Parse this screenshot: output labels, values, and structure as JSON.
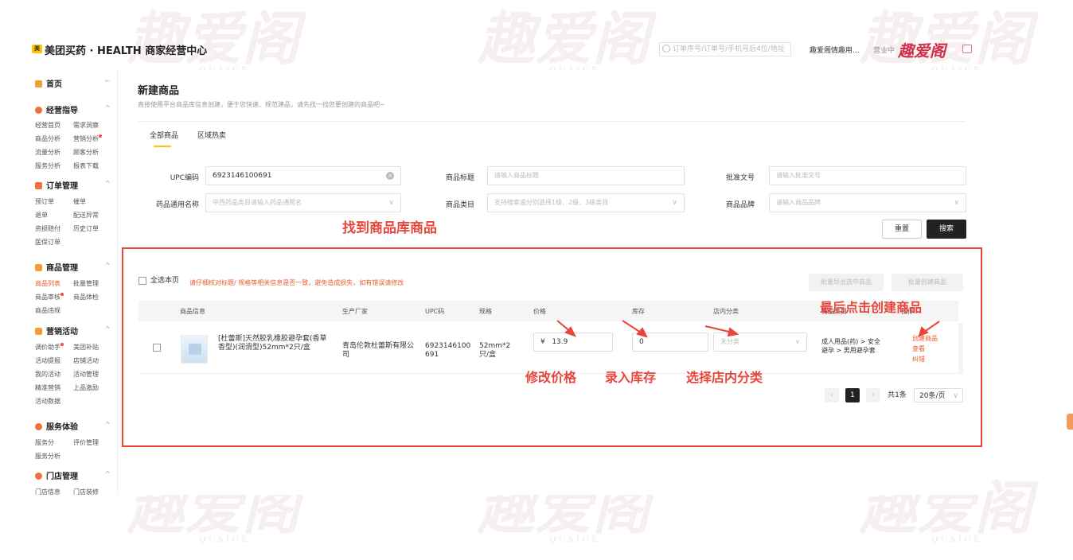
{
  "header": {
    "brand": "美团买药 · HEALTH 商家经营中心",
    "search_placeholder": "订单序号/订单号/手机号后4位/地址",
    "shop_name": "趣爱阁情趣用...",
    "shop_status": "营业中",
    "watermark": "趣爱阁",
    "watermark_sub": "QUAIGE"
  },
  "sidebar": {
    "home": "首页",
    "groups": [
      {
        "label": "经营指导",
        "items": [
          "经营首页",
          "需求洞察",
          "商品分析",
          "营销分析",
          "流量分析",
          "顾客分析",
          "服务分析",
          "报表下载"
        ]
      },
      {
        "label": "订单管理",
        "items": [
          "预订单",
          "催单",
          "退单",
          "配送异常",
          "资损赔付",
          "历史订单",
          "医保订单"
        ]
      },
      {
        "label": "商品管理",
        "items": [
          "商品列表",
          "批量管理",
          "商品审核",
          "商品体检",
          "商品违规"
        ]
      },
      {
        "label": "营销活动",
        "items": [
          "调价助手",
          "美团补贴",
          "活动提报",
          "店铺活动",
          "我的活动",
          "活动管理",
          "精准营销",
          "上品激励",
          "活动数据"
        ]
      },
      {
        "label": "服务体验",
        "items": [
          "服务分",
          "评价管理",
          "服务分析"
        ]
      },
      {
        "label": "门店管理",
        "items": [
          "门店信息",
          "门店装修"
        ]
      }
    ]
  },
  "main": {
    "title": "新建商品",
    "subtitle": "直接使用平台商品库信息创建，便于您快速、规范建品，请先找一找您要创建的商品吧~",
    "tabs": [
      "全部商品",
      "区域热卖"
    ],
    "form": {
      "upc_label": "UPC编码",
      "upc_value": "6923146100691",
      "title_label": "商品标题",
      "title_placeholder": "请输入商品标题",
      "approval_label": "批准文号",
      "approval_placeholder": "请输入批准文号",
      "generic_label": "药品通用名称",
      "generic_placeholder": "中西药品类目请输入药品通用名",
      "category_label": "商品类目",
      "category_placeholder": "支持搜索或分别选择1级、2级、3级类目",
      "brand_label": "商品品牌",
      "brand_placeholder": "请输入商品品牌",
      "reset": "重置",
      "search": "搜索"
    },
    "select_all": "全选本页",
    "warning": "请仔细核对标题/ 规格等相关信息是否一致，避免造成损失，如有错误请修改",
    "bulk_export": "批量导出选中商品",
    "bulk_create": "批量创建商品",
    "table": {
      "headers": [
        "商品信息",
        "生产厂家",
        "UPC码",
        "规格",
        "价格",
        "库存",
        "店内分类",
        "商品类目",
        "操作"
      ],
      "rows": [
        {
          "name": "[杜蕾斯]天然胶乳橡胶避孕套(香草香型)(润滑型)52mm*2只/盒",
          "manufacturer": "青岛伦敦杜蕾斯有限公司",
          "upc": "6923146100691",
          "spec": "52mm*2只/盒",
          "currency": "¥",
          "price": "13.9",
          "stock": "0",
          "shop_category": "未分类",
          "category": "成人用品(药) > 安全避孕 > 男用避孕套",
          "actions": [
            "创建商品",
            "查看",
            "纠错"
          ]
        }
      ]
    },
    "pagination": {
      "prev": "‹",
      "current": "1",
      "next": "›",
      "total": "共1条",
      "page_size": "20条/页"
    }
  },
  "annotations": {
    "find": "找到商品库商品",
    "final": "最后点击创建商品",
    "price": "修改价格",
    "stock": "录入库存",
    "category": "选择店内分类"
  }
}
